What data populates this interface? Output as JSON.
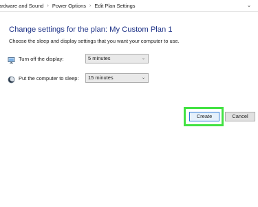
{
  "address_bar": {
    "crumbs": [
      "ardware and Sound",
      "Power Options",
      "Edit Plan Settings"
    ],
    "separator": "›"
  },
  "main": {
    "title": "Change settings for the plan: My Custom Plan 1",
    "subtitle": "Choose the sleep and display settings that you want your computer to use.",
    "settings": [
      {
        "label": "Turn off the display:",
        "icon": "monitor-icon",
        "value": "5 minutes"
      },
      {
        "label": "Put the computer to sleep:",
        "icon": "moon-icon",
        "value": "15 minutes"
      }
    ],
    "buttons": {
      "create": "Create",
      "cancel": "Cancel"
    }
  },
  "colors": {
    "title": "#1e3287",
    "highlight": "#43e243",
    "focus_border": "#2d7ad6"
  }
}
